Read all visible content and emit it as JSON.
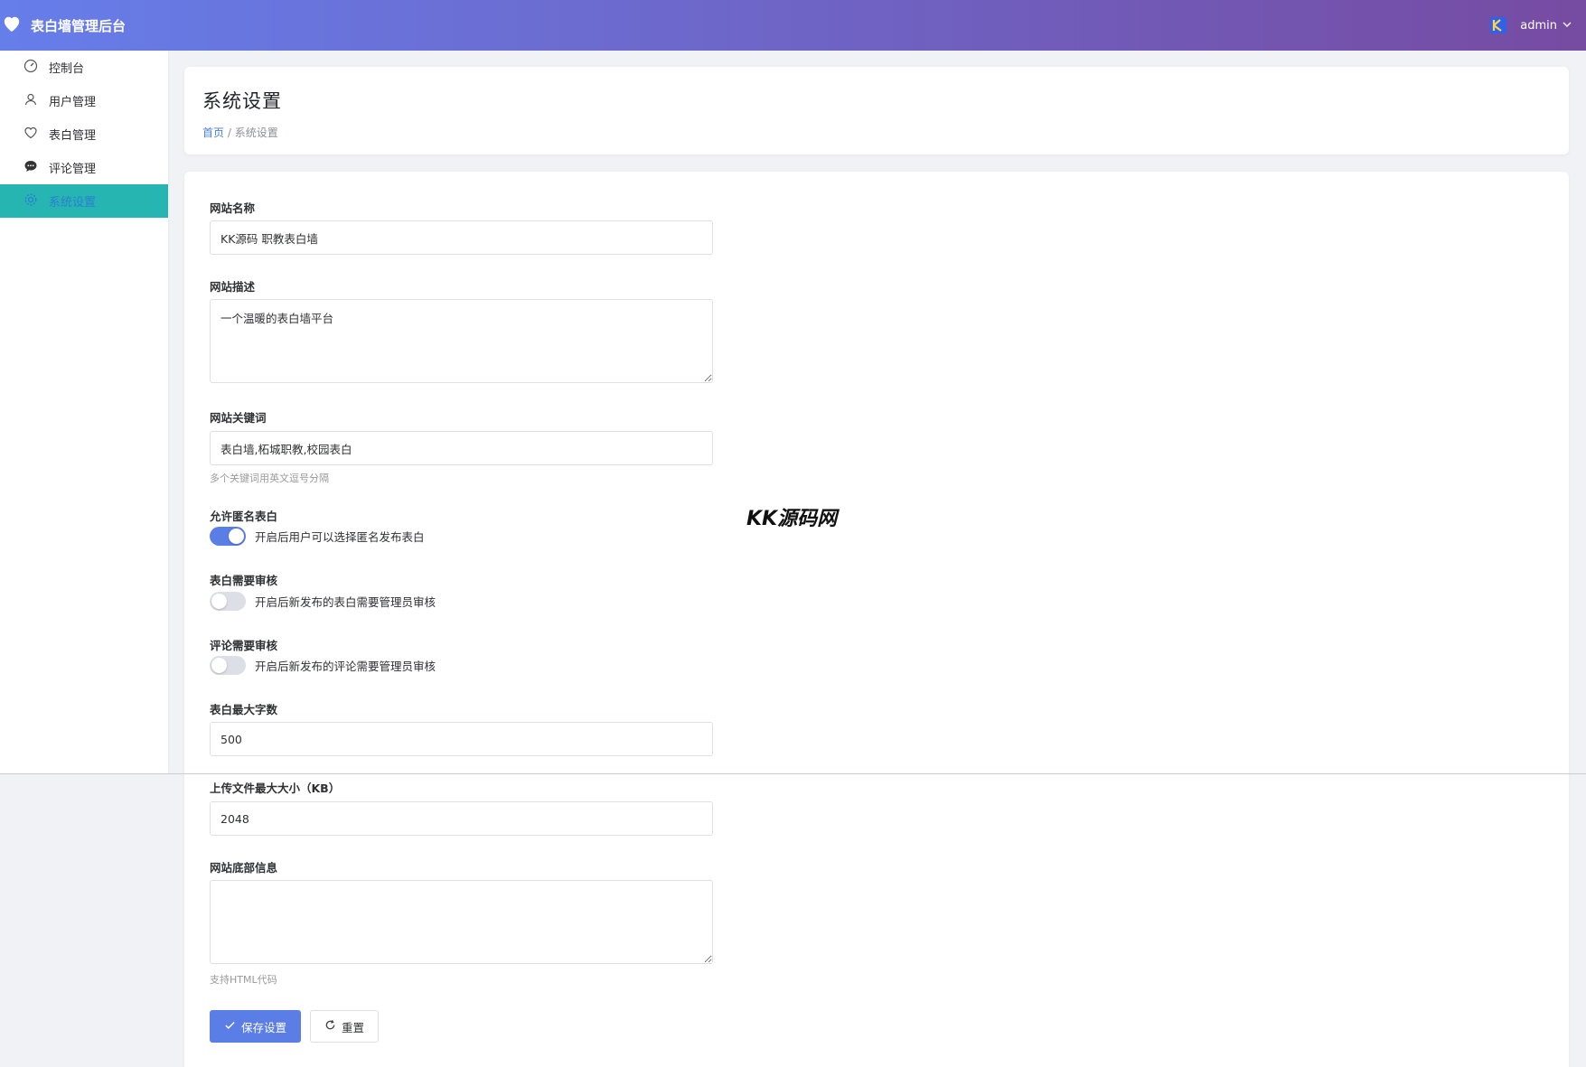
{
  "app": {
    "title": "表白墙管理后台",
    "user": "admin"
  },
  "sidebar": {
    "items": [
      {
        "label": "控制台",
        "icon": "dashboard-icon"
      },
      {
        "label": "用户管理",
        "icon": "user-icon"
      },
      {
        "label": "表白管理",
        "icon": "heart-outline-icon"
      },
      {
        "label": "评论管理",
        "icon": "comment-icon"
      },
      {
        "label": "系统设置",
        "icon": "gear-icon",
        "active": true
      }
    ]
  },
  "header": {
    "title": "系统设置",
    "breadcrumb_home": "首页",
    "breadcrumb_sep": "/",
    "breadcrumb_current": "系统设置"
  },
  "form": {
    "site_name": {
      "label": "网站名称",
      "value": "KK源码 职教表白墙"
    },
    "site_desc": {
      "label": "网站描述",
      "value": "一个温暖的表白墙平台"
    },
    "site_keywords": {
      "label": "网站关键词",
      "value": "表白墙,柘城职教,校园表白",
      "hint": "多个关键词用英文逗号分隔"
    },
    "allow_anonymous": {
      "label": "允许匿名表白",
      "on": true,
      "desc": "开启后用户可以选择匿名发布表白"
    },
    "confession_review": {
      "label": "表白需要审核",
      "on": false,
      "desc": "开启后新发布的表白需要管理员审核"
    },
    "comment_review": {
      "label": "评论需要审核",
      "on": false,
      "desc": "开启后新发布的评论需要管理员审核"
    },
    "max_chars": {
      "label": "表白最大字数",
      "value": "500"
    },
    "max_upload": {
      "label": "上传文件最大大小（KB）",
      "value": "2048"
    },
    "footer_info": {
      "label": "网站底部信息",
      "value": "",
      "hint": "支持HTML代码"
    },
    "save_label": "保存设置",
    "reset_label": "重置"
  },
  "watermark": "KK源码网",
  "colors": {
    "primary": "#5b7ee6",
    "topbar_start": "#667eea",
    "topbar_end": "#764ba2",
    "active_menu": "#26b5b0"
  }
}
